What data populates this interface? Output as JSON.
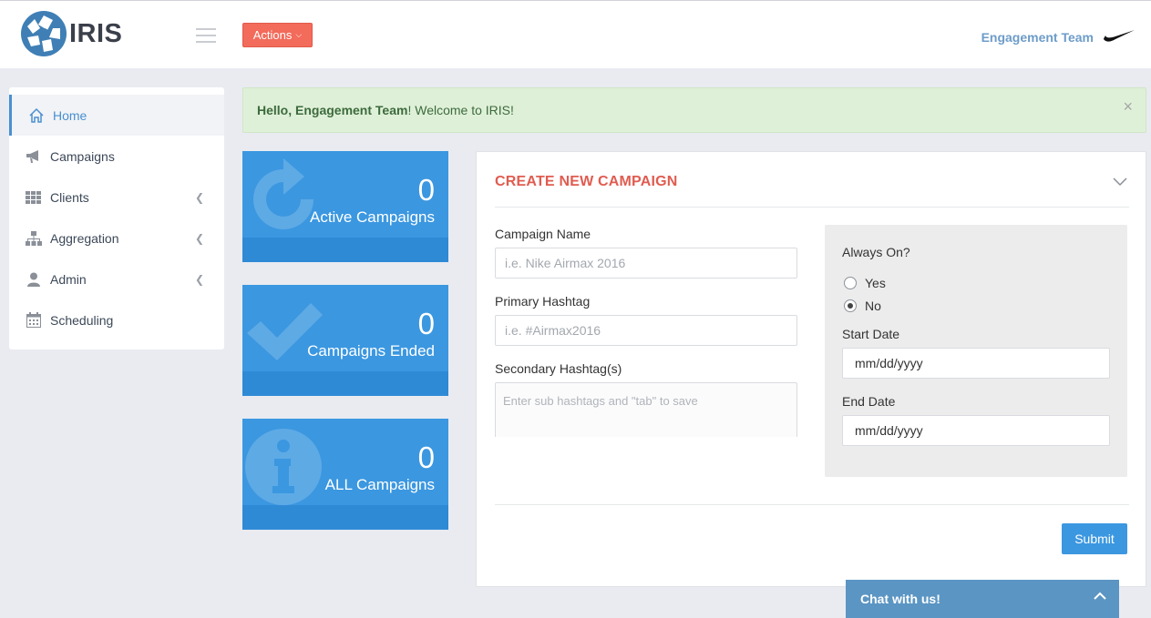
{
  "header": {
    "logo_text": "IRIS",
    "actions_label": "Actions",
    "team_name": "Engagement Team",
    "brand_icon": "nike-swoosh-icon"
  },
  "sidebar": {
    "items": [
      {
        "label": "Home",
        "icon": "home-icon",
        "active": true
      },
      {
        "label": "Campaigns",
        "icon": "megaphone-icon"
      },
      {
        "label": "Clients",
        "icon": "grid-icon",
        "expandable": true
      },
      {
        "label": "Aggregation",
        "icon": "sitemap-icon",
        "expandable": true
      },
      {
        "label": "Admin",
        "icon": "user-icon",
        "expandable": true
      },
      {
        "label": "Scheduling",
        "icon": "calendar-icon"
      }
    ]
  },
  "alert": {
    "greeting": "Hello, Engagement Team",
    "message": "! Welcome to IRIS!",
    "close": "×"
  },
  "stats": [
    {
      "value": "0",
      "label": "Active Campaigns",
      "icon": "refresh-icon"
    },
    {
      "value": "0",
      "label": "Campaigns Ended",
      "icon": "check-icon"
    },
    {
      "value": "0",
      "label": "ALL Campaigns",
      "icon": "info-icon"
    }
  ],
  "form": {
    "title": "CREATE NEW CAMPAIGN",
    "campaign_name_label": "Campaign Name",
    "campaign_name_placeholder": "i.e. Nike Airmax 2016",
    "primary_hashtag_label": "Primary Hashtag",
    "primary_hashtag_placeholder": "i.e. #Airmax2016",
    "secondary_hashtag_label": "Secondary Hashtag(s)",
    "secondary_hashtag_placeholder": "Enter sub hashtags and \"tab\" to save",
    "always_on_label": "Always On?",
    "always_on_options": [
      {
        "label": "Yes",
        "checked": false
      },
      {
        "label": "No",
        "checked": true
      }
    ],
    "start_date_label": "Start Date",
    "start_date_value": "mm/dd/yyyy",
    "end_date_label": "End Date",
    "end_date_value": "mm/dd/yyyy",
    "submit_label": "Submit"
  },
  "chat": {
    "label": "Chat with us!"
  },
  "colors": {
    "primary": "#3b97e0",
    "danger": "#f26b5b",
    "title_red": "#e05c50",
    "success_bg": "#dff0d8"
  }
}
